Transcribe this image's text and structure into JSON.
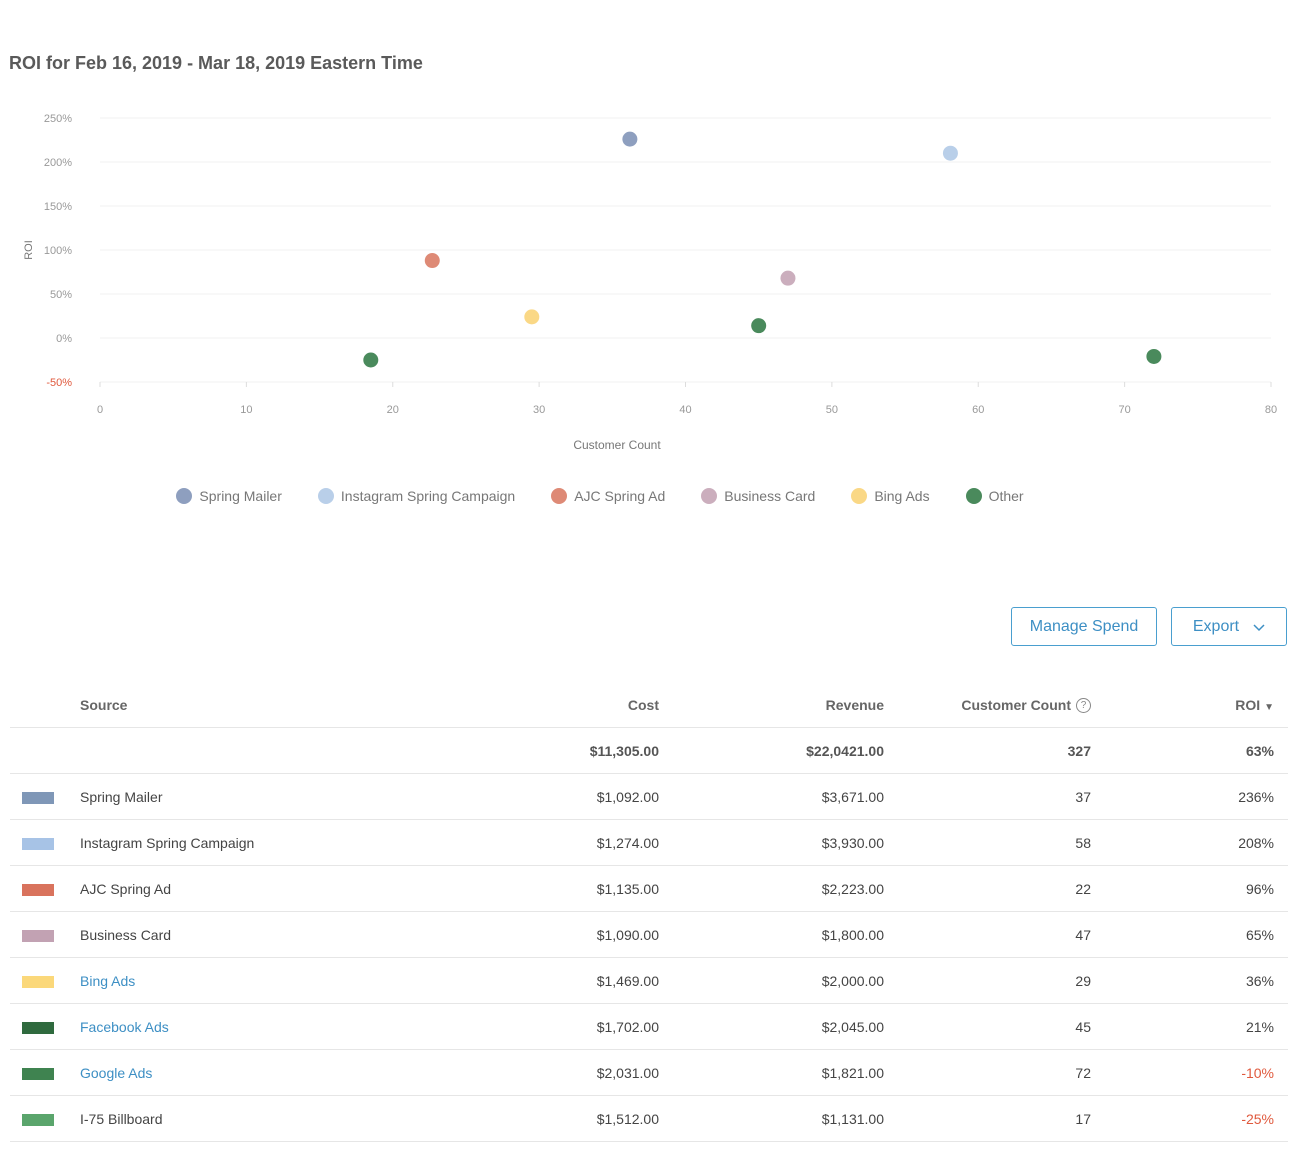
{
  "page": {
    "title": "ROI for Feb 16, 2019 - Mar 18, 2019 Eastern Time"
  },
  "chart_data": {
    "type": "scatter",
    "xlabel": "Customer Count",
    "ylabel": "ROI",
    "xlim": [
      0,
      80
    ],
    "ylim": [
      -50,
      250
    ],
    "x_ticks": [
      "0",
      "10",
      "20",
      "30",
      "40",
      "50",
      "60",
      "70",
      "80"
    ],
    "y_ticks": [
      "250%",
      "200%",
      "150%",
      "100%",
      "50%",
      "0%",
      "-50%"
    ],
    "grid": true,
    "legend_position": "bottom",
    "series": [
      {
        "name": "Spring Mailer",
        "color": "#8e9fbf",
        "points": [
          {
            "x": 36.2,
            "y": 226
          }
        ]
      },
      {
        "name": "Instagram Spring Campaign",
        "color": "#b9cfe9",
        "points": [
          {
            "x": 58.1,
            "y": 210
          }
        ]
      },
      {
        "name": "AJC Spring Ad",
        "color": "#de8a76",
        "points": [
          {
            "x": 22.7,
            "y": 88
          }
        ]
      },
      {
        "name": "Business Card",
        "color": "#cbaebd",
        "points": [
          {
            "x": 47.0,
            "y": 68
          }
        ]
      },
      {
        "name": "Bing Ads",
        "color": "#fad886",
        "points": [
          {
            "x": 29.5,
            "y": 24
          }
        ]
      },
      {
        "name": "Other",
        "color": "#4a8a5c",
        "points": [
          {
            "x": 45.0,
            "y": 14
          },
          {
            "x": 72.0,
            "y": -21
          },
          {
            "x": 18.5,
            "y": -25
          }
        ]
      }
    ]
  },
  "buttons": {
    "manage_spend": "Manage Spend",
    "export": "Export"
  },
  "table": {
    "headers": {
      "source": "Source",
      "cost": "Cost",
      "revenue": "Revenue",
      "customer_count": "Customer Count",
      "roi": "ROI"
    },
    "help_icon": "?",
    "totals": {
      "cost": "$11,305.00",
      "revenue": "$22,0421.00",
      "customer_count": "327",
      "roi": "63%"
    },
    "rows": [
      {
        "color": "#7f97b7",
        "source": "Spring Mailer",
        "link": false,
        "cost": "$1,092.00",
        "revenue": "$3,671.00",
        "customer_count": "37",
        "roi": "236%",
        "negative": false
      },
      {
        "color": "#a7c3e6",
        "source": "Instagram Spring Campaign",
        "link": false,
        "cost": "$1,274.00",
        "revenue": "$3,930.00",
        "customer_count": "58",
        "roi": "208%",
        "negative": false
      },
      {
        "color": "#d9735d",
        "source": "AJC Spring Ad",
        "link": false,
        "cost": "$1,135.00",
        "revenue": "$2,223.00",
        "customer_count": "22",
        "roi": "96%",
        "negative": false
      },
      {
        "color": "#c2a2b3",
        "source": "Business Card",
        "link": false,
        "cost": "$1,090.00",
        "revenue": "$1,800.00",
        "customer_count": "47",
        "roi": "65%",
        "negative": false
      },
      {
        "color": "#fbd87a",
        "source": "Bing Ads",
        "link": true,
        "cost": "$1,469.00",
        "revenue": "$2,000.00",
        "customer_count": "29",
        "roi": "36%",
        "negative": false
      },
      {
        "color": "#2f6a3e",
        "source": "Facebook Ads",
        "link": true,
        "cost": "$1,702.00",
        "revenue": "$2,045.00",
        "customer_count": "45",
        "roi": "21%",
        "negative": false
      },
      {
        "color": "#3f8350",
        "source": "Google Ads",
        "link": true,
        "cost": "$2,031.00",
        "revenue": "$1,821.00",
        "customer_count": "72",
        "roi": "-10%",
        "negative": true
      },
      {
        "color": "#5aa56c",
        "source": "I-75 Billboard",
        "link": false,
        "cost": "$1,512.00",
        "revenue": "$1,131.00",
        "customer_count": "17",
        "roi": "-25%",
        "negative": true
      }
    ]
  }
}
